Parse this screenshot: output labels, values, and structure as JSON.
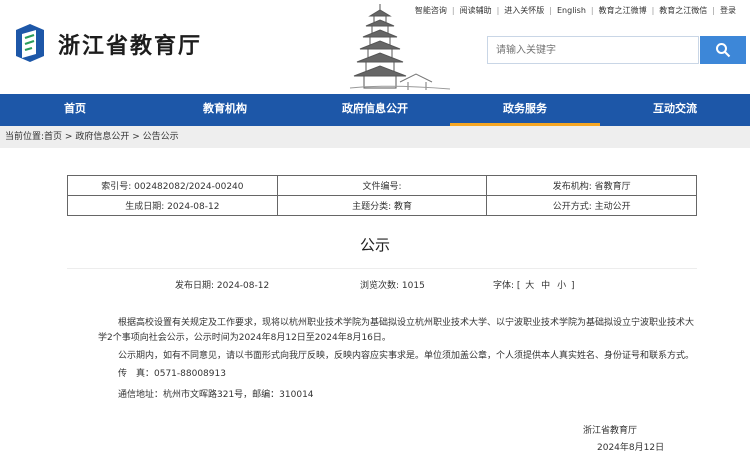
{
  "site": {
    "title": "浙江省教育厅"
  },
  "toplinks": [
    "智能咨询",
    "阅读辅助",
    "进入关怀版",
    "English",
    "教育之江微博",
    "教育之江微信",
    "登录"
  ],
  "search": {
    "placeholder": "请输入关键字"
  },
  "nav": [
    {
      "label": "首页"
    },
    {
      "label": "教育机构"
    },
    {
      "label": "政府信息公开"
    },
    {
      "label": "政务服务"
    },
    {
      "label": "互动交流"
    }
  ],
  "breadcrumb": {
    "prefix": "当前位置:",
    "items": [
      "首页",
      "政府信息公开",
      "公告公示"
    ],
    "sep": " > "
  },
  "meta": {
    "row1": [
      "索引号: 002482082/2024-00240",
      "文件编号:",
      "发布机构: 省教育厅"
    ],
    "row2": [
      "生成日期: 2024-08-12",
      "主题分类: 教育",
      "公开方式: 主动公开"
    ]
  },
  "article": {
    "title": "公示",
    "publish_date": "发布日期: 2024-08-12",
    "views": "浏览次数: 1015",
    "font_label": "字体: [",
    "font_large": "大",
    "font_medium": "中",
    "font_small": "小",
    "font_close": "]",
    "para1": "根据高校设置有关规定及工作要求，现将以杭州职业技术学院为基础拟设立杭州职业技术大学、以宁波职业技术学院为基础拟设立宁波职业技术大学2个事项向社会公示，公示时间为2024年8月12日至2024年8月16日。",
    "para2": "公示期内，如有不同意见，请以书面形式向我厅反映，反映内容应实事求是。单位须加盖公章，个人须提供本人真实姓名、身份证号和联系方式。",
    "fax": "传　真：0571-88008913",
    "address": "通信地址：杭州市文晖路321号，邮编：310014",
    "signature": "浙江省教育厅",
    "date": "2024年8月12日"
  },
  "colors": {
    "nav_bg": "#1d57a8",
    "nav_active": "#f5a623",
    "search_btn": "#3d87d8"
  }
}
